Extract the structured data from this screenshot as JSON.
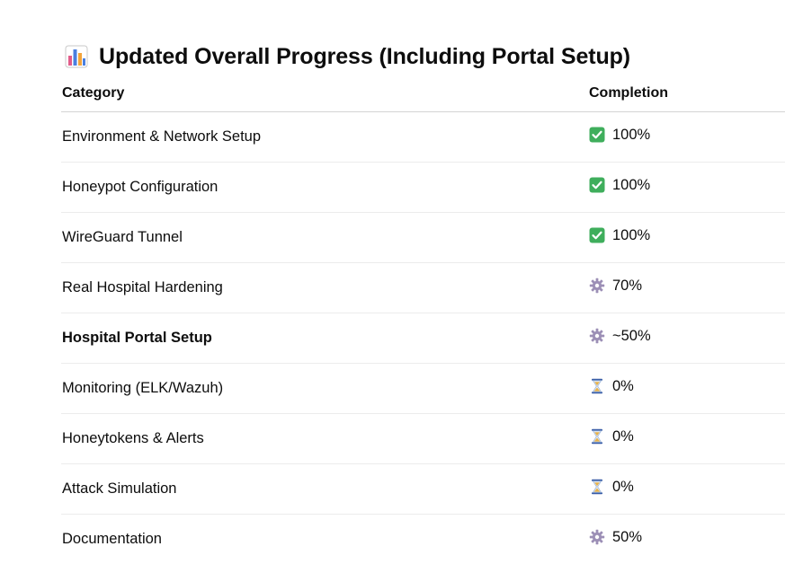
{
  "heading": {
    "icon": "bar-chart-icon",
    "title": "Updated Overall Progress (Including Portal Setup)"
  },
  "table": {
    "headers": {
      "category": "Category",
      "completion": "Completion"
    },
    "rows": [
      {
        "category": "Environment & Network Setup",
        "icon": "check-mark-icon",
        "value": "100%",
        "bold": false
      },
      {
        "category": "Honeypot Configuration",
        "icon": "check-mark-icon",
        "value": "100%",
        "bold": false
      },
      {
        "category": "WireGuard Tunnel",
        "icon": "check-mark-icon",
        "value": "100%",
        "bold": false
      },
      {
        "category": "Real Hospital Hardening",
        "icon": "gear-icon",
        "value": "70%",
        "bold": false
      },
      {
        "category": "Hospital Portal Setup",
        "icon": "gear-icon",
        "value": "~50%",
        "bold": true
      },
      {
        "category": "Monitoring (ELK/Wazuh)",
        "icon": "hourglass-icon",
        "value": "0%",
        "bold": false
      },
      {
        "category": "Honeytokens & Alerts",
        "icon": "hourglass-icon",
        "value": "0%",
        "bold": false
      },
      {
        "category": "Attack Simulation",
        "icon": "hourglass-icon",
        "value": "0%",
        "bold": false
      },
      {
        "category": "Documentation",
        "icon": "gear-icon",
        "value": "50%",
        "bold": false
      }
    ]
  },
  "colors": {
    "check": "#3fae5c",
    "gear": "#9c8fb6",
    "hourglass_frame": "#3a5ea8",
    "hourglass_sand": "#e8b24a"
  }
}
